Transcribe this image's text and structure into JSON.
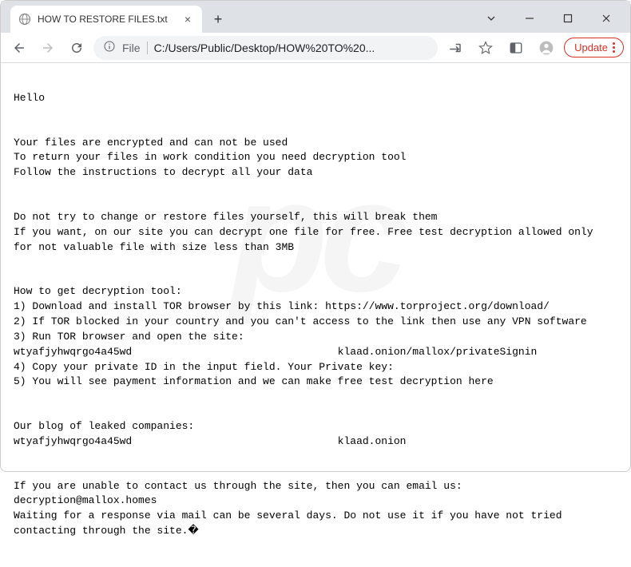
{
  "tab": {
    "title": "HOW TO RESTORE FILES.txt"
  },
  "toolbar": {
    "url_label": "File",
    "url": "C:/Users/Public/Desktop/HOW%20TO%20...",
    "update_label": "Update"
  },
  "watermark": "pc",
  "content": {
    "p1": "Hello",
    "p2_l1": "Your files are encrypted and can not be used",
    "p2_l2": "To return your files in work condition you need decryption tool",
    "p2_l3": "Follow the instructions to decrypt all your data",
    "p3_l1": "Do not try to change or restore files yourself, this will break them",
    "p3_l2": "If you want, on our site you can decrypt one file for free. Free test decryption allowed only for not valuable file with size less than 3MB",
    "p4_l1": "How to get decryption tool:",
    "p4_l2": "1) Download and install TOR browser by this link: https://www.torproject.org/download/",
    "p4_l3": "2) If TOR blocked in your country and you can't access to the link then use any VPN software",
    "p4_l4": "3) Run TOR browser and open the site:",
    "p4_l5": "wtyafjyhwqrgo4a45wd                                 klaad.onion/mallox/privateSignin",
    "p4_l6": "4) Copy your private ID in the input field. Your Private key:",
    "p4_l7": "5) You will see payment information and we can make free test decryption here",
    "p5_l1": "Our blog of leaked companies:",
    "p5_l2": "wtyafjyhwqrgo4a45wd                                 klaad.onion",
    "p6_l1": "If you are unable to contact us through the site, then you can email us:",
    "p6_l2": "decryption@mallox.homes",
    "p6_l3": "Waiting for a response via mail can be several days. Do not use it if you have not tried contacting through the site.�"
  }
}
